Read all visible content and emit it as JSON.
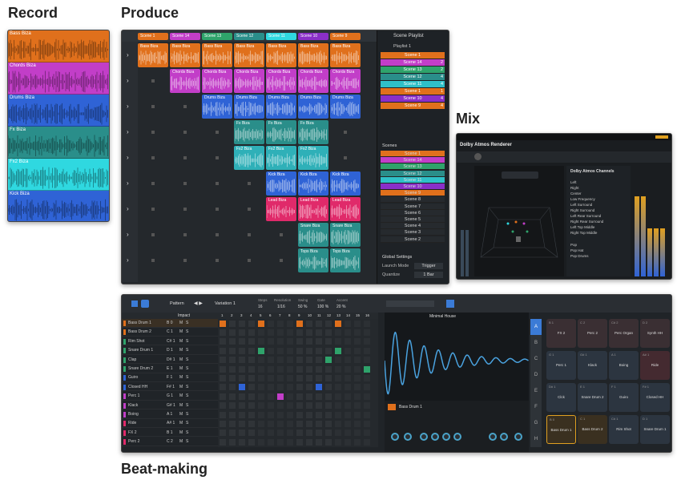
{
  "headings": {
    "record": "Record",
    "produce": "Produce",
    "mix": "Mix",
    "beat": "Beat-making"
  },
  "record": {
    "tracks": [
      {
        "name": "Bass Biza",
        "color": "#e0701c"
      },
      {
        "name": "Chords Biza",
        "color": "#c23ec8"
      },
      {
        "name": "Drums Biza",
        "color": "#2f63d6"
      },
      {
        "name": "Fx Biza",
        "color": "#2a8e8a"
      },
      {
        "name": "Fx2 Biza",
        "color": "#2fd8e0"
      },
      {
        "name": "Kick Biza",
        "color": "#2f63d6"
      }
    ]
  },
  "produce": {
    "scenes": [
      {
        "name": "Scene 1",
        "color": "#e0701c"
      },
      {
        "name": "Scene 14",
        "color": "#c23ec8"
      },
      {
        "name": "Scene 13",
        "color": "#2fa36b"
      },
      {
        "name": "Scene 12",
        "color": "#2a8e8a"
      },
      {
        "name": "Scene 11",
        "color": "#2fd8e0"
      },
      {
        "name": "Scene 10",
        "color": "#8a2fc8"
      },
      {
        "name": "Scene 9",
        "color": "#e0701c"
      }
    ],
    "playlist_title": "Scene Playlist",
    "playlist_name": "Playlist 1",
    "playlist": [
      {
        "name": "Scene 1",
        "color": "#e0701c",
        "n": ""
      },
      {
        "name": "Scene 14",
        "color": "#c23ec8",
        "n": "2"
      },
      {
        "name": "Scene 13",
        "color": "#2fa36b",
        "n": "2"
      },
      {
        "name": "Scene 12",
        "color": "#2a8e8a",
        "n": "4"
      },
      {
        "name": "Scene 11",
        "color": "#2fc0c8",
        "n": "4"
      },
      {
        "name": "Scene 1",
        "color": "#e0701c",
        "n": "1"
      },
      {
        "name": "Scene 10",
        "color": "#8a2fc8",
        "n": "4"
      },
      {
        "name": "Scene 9",
        "color": "#e0701c",
        "n": "4"
      }
    ],
    "scenes_title": "Scenes",
    "scene_list": [
      {
        "name": "Scene 1",
        "color": "#e0701c"
      },
      {
        "name": "Scene 14",
        "color": "#c23ec8"
      },
      {
        "name": "Scene 13",
        "color": "#2fa36b"
      },
      {
        "name": "Scene 12",
        "color": "#2a8e8a"
      },
      {
        "name": "Scene 11",
        "color": "#2fc0c8"
      },
      {
        "name": "Scene 10",
        "color": "#8a2fc8"
      },
      {
        "name": "Scene 9",
        "color": "#e0701c"
      },
      {
        "name": "Scene 8",
        "color": ""
      },
      {
        "name": "Scene 7",
        "color": ""
      },
      {
        "name": "Scene 6",
        "color": ""
      },
      {
        "name": "Scene 5",
        "color": ""
      },
      {
        "name": "Scene 4",
        "color": ""
      },
      {
        "name": "Scene 3",
        "color": ""
      },
      {
        "name": "Scene 2",
        "color": ""
      }
    ],
    "global_settings": "Global Settings",
    "launch_mode_label": "Launch Mode",
    "launch_mode_value": "Trigger",
    "quantize_label": "Quantize",
    "quantize_value": "1 Bar",
    "rows": [
      {
        "name": "Bass Biza",
        "color": "#e0701c",
        "cols": [
          0,
          1,
          2,
          3,
          4,
          5,
          6
        ]
      },
      {
        "name": "Chords Biza",
        "color": "#c23ec8",
        "cols": [
          1,
          2,
          3,
          4,
          5,
          6
        ]
      },
      {
        "name": "Drums Biza",
        "color": "#2f63d6",
        "cols": [
          2,
          3,
          4,
          5,
          6
        ]
      },
      {
        "name": "Fx Biza",
        "color": "#2a8e8a",
        "cols": [
          3,
          4,
          5
        ]
      },
      {
        "name": "Fx2 Biza",
        "color": "#2fb0b8",
        "cols": [
          3,
          4,
          5
        ]
      },
      {
        "name": "Kick Biza",
        "color": "#2f63d6",
        "cols": [
          4,
          5,
          6
        ]
      },
      {
        "name": "Lead Biza",
        "color": "#e02a6a",
        "cols": [
          4,
          5,
          6
        ]
      },
      {
        "name": "Snare Biza",
        "color": "#2a8e8a",
        "cols": [
          5,
          6
        ]
      },
      {
        "name": "Tops Biza",
        "color": "#2a8e8a",
        "cols": [
          5,
          6
        ]
      }
    ]
  },
  "mix": {
    "title": "Dolby Atmos Renderer",
    "header": "Dolby Atmos Channels",
    "channels": [
      "Left",
      "Right",
      "Center",
      "Low Frequency",
      "Left Surround",
      "Right Surround",
      "Left Rear Surround",
      "Right Rear Surround",
      "Left Top Middle",
      "Right Top Middle"
    ],
    "objects": [
      "Pop",
      "Pop Hat",
      "Pop Drums"
    ]
  },
  "beat": {
    "pattern_label": "Pattern",
    "variation": "Variation 1",
    "steps_label": "Steps",
    "steps_value": "16",
    "resolution_label": "Resolution",
    "resolution_value": "1/16",
    "swing_label": "Swing",
    "swing_value": "50 %",
    "gate_label": "Gate",
    "gate_value": "100 %",
    "accent_label": "Accent",
    "accent_value": "20 %",
    "impact_label": "Impact",
    "instruments": [
      {
        "name": "Bass Drum 1",
        "note": "B 0",
        "color": "#e0701c"
      },
      {
        "name": "Bass Drum 2",
        "note": "C 1",
        "color": "#e0701c"
      },
      {
        "name": "Rim Shot",
        "note": "C# 1",
        "color": "#2fa36b"
      },
      {
        "name": "Snare Drum 1",
        "note": "D 1",
        "color": "#2fa36b"
      },
      {
        "name": "Clap",
        "note": "D# 1",
        "color": "#2fa36b"
      },
      {
        "name": "Snare Drum 2",
        "note": "E 1",
        "color": "#2fa36b"
      },
      {
        "name": "Guiro",
        "note": "F 1",
        "color": "#2f63d6"
      },
      {
        "name": "Closed HH",
        "note": "F# 1",
        "color": "#2f63d6"
      },
      {
        "name": "Perc 1",
        "note": "G 1",
        "color": "#c23ec8"
      },
      {
        "name": "Klack",
        "note": "G# 1",
        "color": "#c23ec8"
      },
      {
        "name": "Boing",
        "note": "A 1",
        "color": "#c23ec8"
      },
      {
        "name": "Ride",
        "note": "A# 1",
        "color": "#e02a6a"
      },
      {
        "name": "FX 2",
        "note": "B 1",
        "color": "#e02a6a"
      },
      {
        "name": "Perc 2",
        "note": "C 2",
        "color": "#e02a6a"
      }
    ],
    "sample_name": "Minimal House",
    "instrument_name": "Bass Drum 1",
    "pads": [
      {
        "name": "FX 2",
        "note": "B 1",
        "color": "#3a2f33"
      },
      {
        "name": "Perc 2",
        "note": "C 2",
        "color": "#3a2f33"
      },
      {
        "name": "Perc Organ",
        "note": "C# 2",
        "color": "#3a2f33"
      },
      {
        "name": "Synth HH",
        "note": "D 2",
        "color": "#3a2f33"
      },
      {
        "name": "Perc 1",
        "note": "G 1",
        "color": "#2c3540"
      },
      {
        "name": "Klack",
        "note": "G# 1",
        "color": "#2c3540"
      },
      {
        "name": "Boing",
        "note": "A 1",
        "color": "#2c3540"
      },
      {
        "name": "Ride",
        "note": "A# 1",
        "color": "#442a30"
      },
      {
        "name": "Clck",
        "note": "D# 1",
        "color": "#2c3540"
      },
      {
        "name": "Snare Drum 2",
        "note": "E 1",
        "color": "#2c3540"
      },
      {
        "name": "Guiro",
        "note": "F 1",
        "color": "#2c3540"
      },
      {
        "name": "Closed HH",
        "note": "F# 1",
        "color": "#2c3540"
      },
      {
        "name": "Bass Drum 1",
        "note": "B 0",
        "color": "#3a3020"
      },
      {
        "name": "Bass Drum 2",
        "note": "C 1",
        "color": "#3a3020"
      },
      {
        "name": "Rim Shot",
        "note": "C# 1",
        "color": "#2c3540"
      },
      {
        "name": "Snare Drum 1",
        "note": "D 1",
        "color": "#2c3540"
      }
    ],
    "banks": [
      "A",
      "B",
      "C",
      "D",
      "E",
      "F",
      "G",
      "H"
    ]
  }
}
